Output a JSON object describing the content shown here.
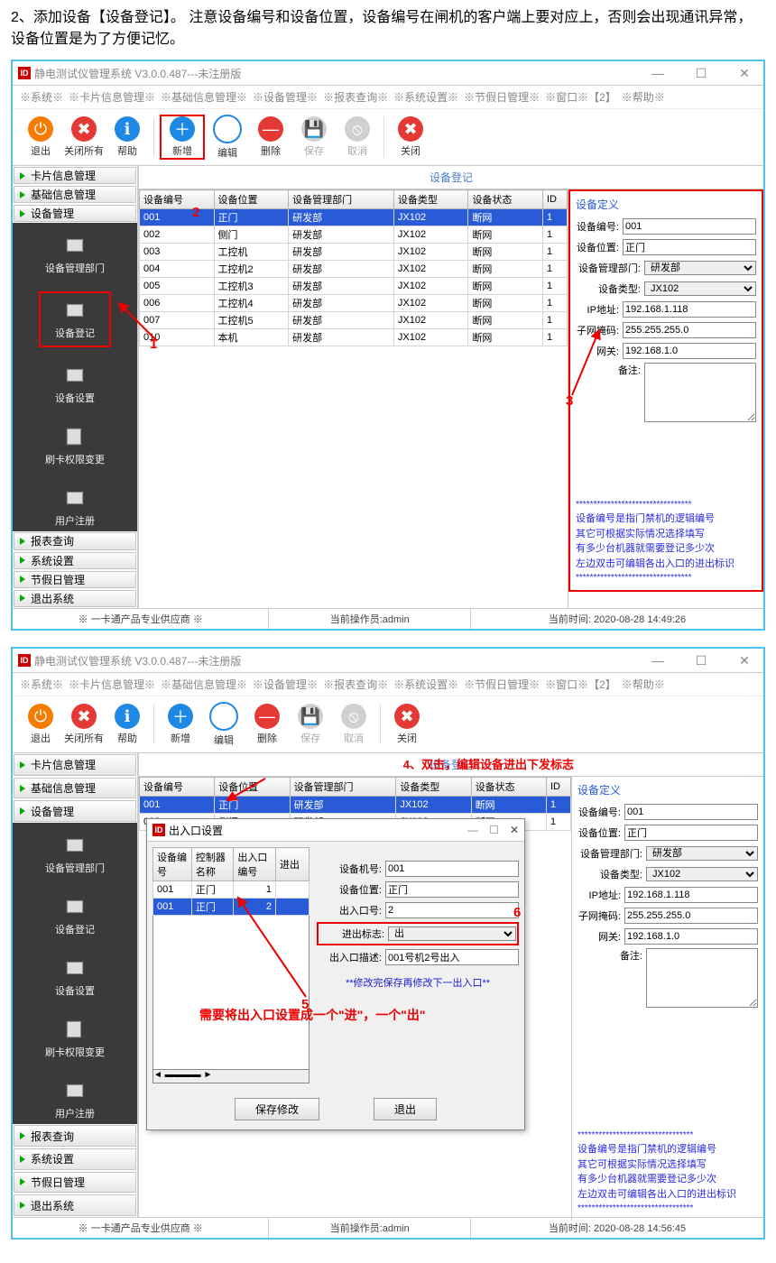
{
  "instruction": "2、添加设备【设备登记】。 注意设备编号和设备位置，设备编号在闸机的客户端上要对应上，否则会出现通讯异常，设备位置是为了方便记忆。",
  "app_title": "静电测试仪管理系统 V3.0.0.487---未注册版",
  "menu": [
    "※系统※",
    "※卡片信息管理※",
    "※基础信息管理※",
    "※设备管理※",
    "※报表查询※",
    "※系统设置※",
    "※节假日管理※",
    "※窗口※【2】",
    "※帮助※"
  ],
  "tb": {
    "exit": "退出",
    "closeall": "关闭所有",
    "help": "帮助",
    "add": "新增",
    "edit": "编辑",
    "del": "删除",
    "save": "保存",
    "cancel": "取消",
    "close": "关闭"
  },
  "nav_top": [
    "卡片信息管理",
    "基础信息管理",
    "设备管理"
  ],
  "nav_items": [
    "设备管理部门",
    "设备登记",
    "设备设置",
    "刷卡权限变更",
    "用户注册"
  ],
  "nav_bottom": [
    "报表查询",
    "系统设置",
    "节假日管理",
    "退出系统"
  ],
  "main_title": "设备登记",
  "cols": [
    "设备编号",
    "设备位置",
    "设备管理部门",
    "设备类型",
    "设备状态",
    "ID"
  ],
  "rows": [
    [
      "001",
      "正门",
      "研发部",
      "JX102",
      "断网",
      "1"
    ],
    [
      "002",
      "侧门",
      "研发部",
      "JX102",
      "断网",
      "1"
    ],
    [
      "003",
      "工控机",
      "研发部",
      "JX102",
      "断网",
      "1"
    ],
    [
      "004",
      "工控机2",
      "研发部",
      "JX102",
      "断网",
      "1"
    ],
    [
      "005",
      "工控机3",
      "研发部",
      "JX102",
      "断网",
      "1"
    ],
    [
      "006",
      "工控机4",
      "研发部",
      "JX102",
      "断网",
      "1"
    ],
    [
      "007",
      "工控机5",
      "研发部",
      "JX102",
      "断网",
      "1"
    ],
    [
      "010",
      "本机",
      "研发部",
      "JX102",
      "断网",
      "1"
    ]
  ],
  "rp_title": "设备定义",
  "rp": {
    "num": "001",
    "pos": "正门",
    "dept": "研发部",
    "type": "JX102",
    "ip": "192.168.1.118",
    "mask": "255.255.255.0",
    "gw": "192.168.1.0",
    "remark": ""
  },
  "rp_labels": {
    "num": "设备编号:",
    "pos": "设备位置:",
    "dept": "设备管理部门:",
    "type": "设备类型:",
    "ip": "IP地址:",
    "mask": "子网掩码:",
    "gw": "网关:",
    "remark": "备注:"
  },
  "notes": [
    "设备编号是指门禁机的逻辑编号",
    "其它可根据实际情况选择填写",
    "有多少台机器就需要登记多少次",
    "左边双击可编辑各出入口的进出标识"
  ],
  "status": {
    "s1": "※ 一卡通产品专业供应商 ※",
    "s2": "当前操作员:admin",
    "s3a": "当前时间:  2020-08-28 14:49:26",
    "s3b": "当前时间:  2020-08-28 14:56:45"
  },
  "ann": {
    "a1": "1",
    "a2": "2",
    "a3": "3",
    "a4": "4、双击，编辑设备进出下发标志",
    "a5": "5",
    "a6": "6",
    "a7": "需要将出入口设置成一个\"进\"，一个\"出\""
  },
  "dlg": {
    "title": "出入口设置",
    "cols": [
      "设备编号",
      "控制器名称",
      "出入口编号",
      "进出"
    ],
    "rows": [
      [
        "001",
        "正门",
        "1",
        ""
      ],
      [
        "001",
        "正门",
        "2",
        ""
      ]
    ],
    "r": {
      "machno": "设备机号:",
      "pos": "设备位置:",
      "ioport": "出入口号:",
      "flag": "进出标志:",
      "desc": "出入口描述:"
    },
    "rv": {
      "machno": "001",
      "pos": "正门",
      "ioport": "2",
      "flag": "出",
      "desc": "001号机2号出入"
    },
    "note": "**修改完保存再修改下一出入口**",
    "save": "保存修改",
    "exit": "退出"
  }
}
